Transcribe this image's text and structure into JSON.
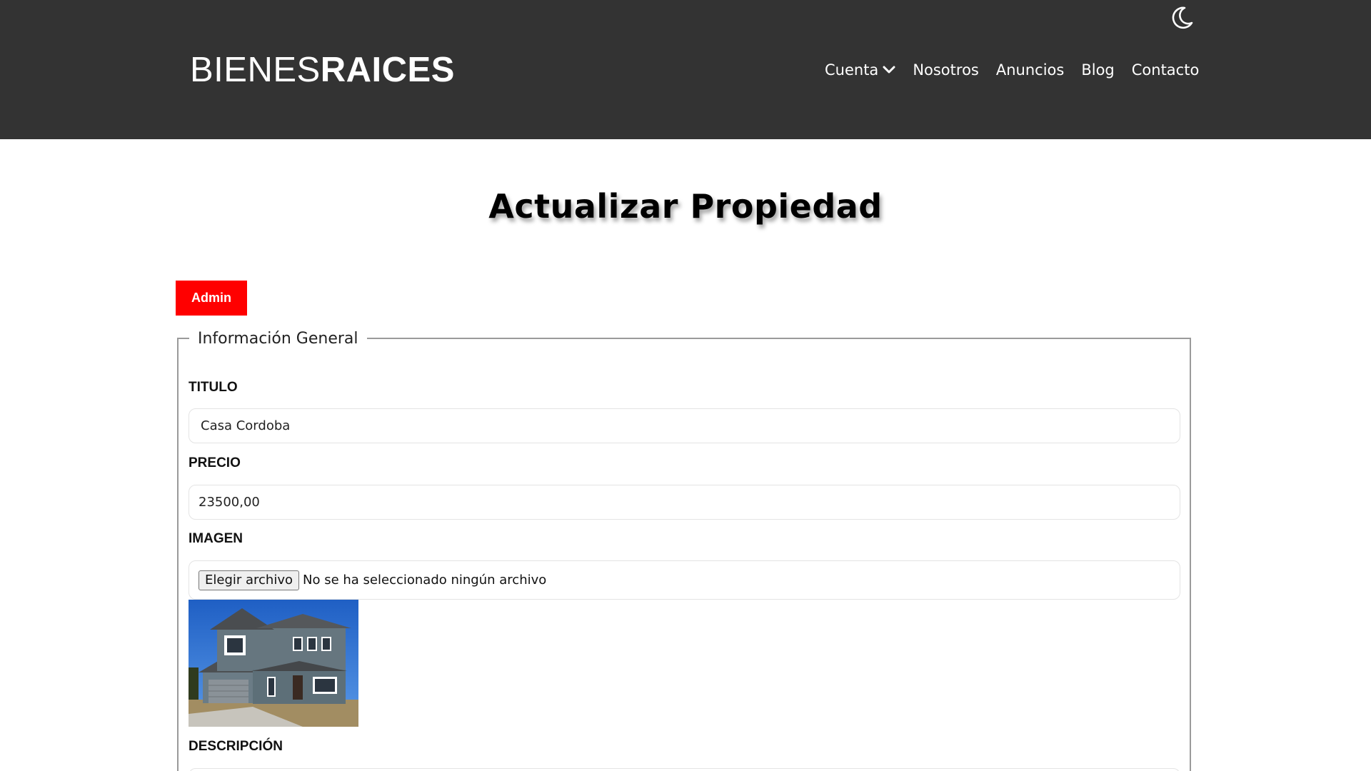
{
  "header": {
    "logo_light": "BIENES",
    "logo_bold": "RAICES",
    "theme_toggle_icon": "moon-icon",
    "nav": {
      "cuenta": "Cuenta",
      "nosotros": "Nosotros",
      "anuncios": "Anuncios",
      "blog": "Blog",
      "contacto": "Contacto"
    },
    "background_color": "#333333"
  },
  "main": {
    "title": "Actualizar Propiedad",
    "admin_button": "Admin",
    "admin_button_color": "#ff0000",
    "fieldset_legend": "Información General",
    "fields": {
      "titulo_label": "TITULO",
      "titulo_value": "Casa Cordoba",
      "precio_label": "PRECIO",
      "precio_value": "23500,00",
      "imagen_label": "IMAGEN",
      "file_button": "Elegir archivo",
      "file_status": "No se ha seleccionado ningún archivo",
      "descripcion_label": "DESCRIPCIÓN"
    }
  }
}
